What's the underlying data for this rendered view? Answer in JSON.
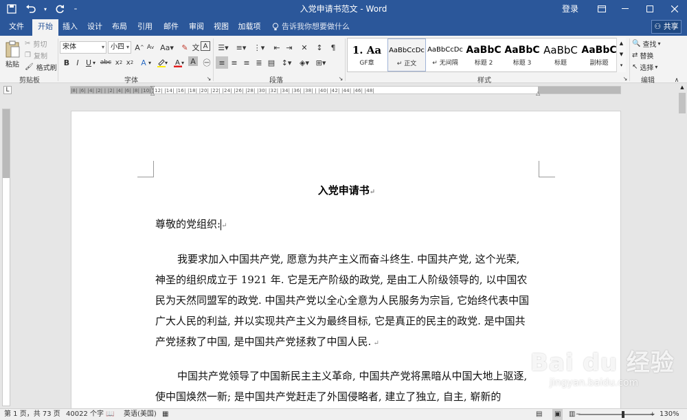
{
  "window": {
    "title": "入党申请书范文 - Word",
    "login": "登录",
    "share": "共享"
  },
  "tabs": [
    "文件",
    "开始",
    "插入",
    "设计",
    "布局",
    "引用",
    "邮件",
    "审阅",
    "视图",
    "加载项"
  ],
  "tell_me": "告诉我你想要做什么",
  "ribbon": {
    "clipboard": {
      "paste": "粘贴",
      "cut": "剪切",
      "copy": "复制",
      "format_painter": "格式刷",
      "label": "剪贴板"
    },
    "font": {
      "name": "宋体",
      "size": "小四",
      "label": "字体"
    },
    "paragraph": {
      "label": "段落"
    },
    "styles": {
      "label": "样式",
      "items": [
        {
          "sample": "1.  Aa",
          "name": "GF章"
        },
        {
          "sample": "AaBbCcDc",
          "name": "正文"
        },
        {
          "sample": "AaBbCcDc",
          "name": "无间隔"
        },
        {
          "sample": "AaBbC",
          "name": "标题 2"
        },
        {
          "sample": "AaBbC",
          "name": "标题 3"
        },
        {
          "sample": "AaBbC",
          "name": "标题"
        },
        {
          "sample": "AaBbC",
          "name": "副标题"
        }
      ]
    },
    "editing": {
      "find": "查找",
      "replace": "替换",
      "select": "选择",
      "label": "编辑"
    }
  },
  "ruler": {
    "tab_marker": "L",
    "labels": "|8| |6| |4| |2| | |2| |4| |6| |8| |10| |12| |14| |16| |18| |20| |22| |24| |26| |28| |30| |32| |34| |36| |38| | |40| |42| |44| |46| |48|"
  },
  "document": {
    "title": "入党申请书",
    "salutation": "尊敬的党组织:",
    "paragraph1": "我要求加入中国共产党, 愿意为共产主义而奋斗终生.  中国共产党, 这个光荣, 神圣的组织成立于  1921  年. 它是无产阶级的政党, 是由工人阶级领导的, 以中国农民为天然同盟军的政党. 中国共产党以全心全意为人民服务为宗旨, 它始终代表中国广大人民的利益, 并以实现共产主义为最终目标, 它是真正的民主的政党.  是中国共产党拯救了中国,  是中国共产党拯救了中国人民.",
    "paragraph2": "中国共产党领导了中国新民主主义革命, 中国共产党将黑暗从中国大地上驱逐, 使中国焕然一新; 是中国共产党赶走了外国侵略者, 建立了独立, 自主, 崭新的"
  },
  "status": {
    "page": "第 1 页，共 73 页",
    "words": "40022 个字",
    "language": "英语(美国)",
    "zoom": "130%"
  },
  "watermark": {
    "brand": "Bai du 经验",
    "url": "jingyan.baidu.com"
  }
}
